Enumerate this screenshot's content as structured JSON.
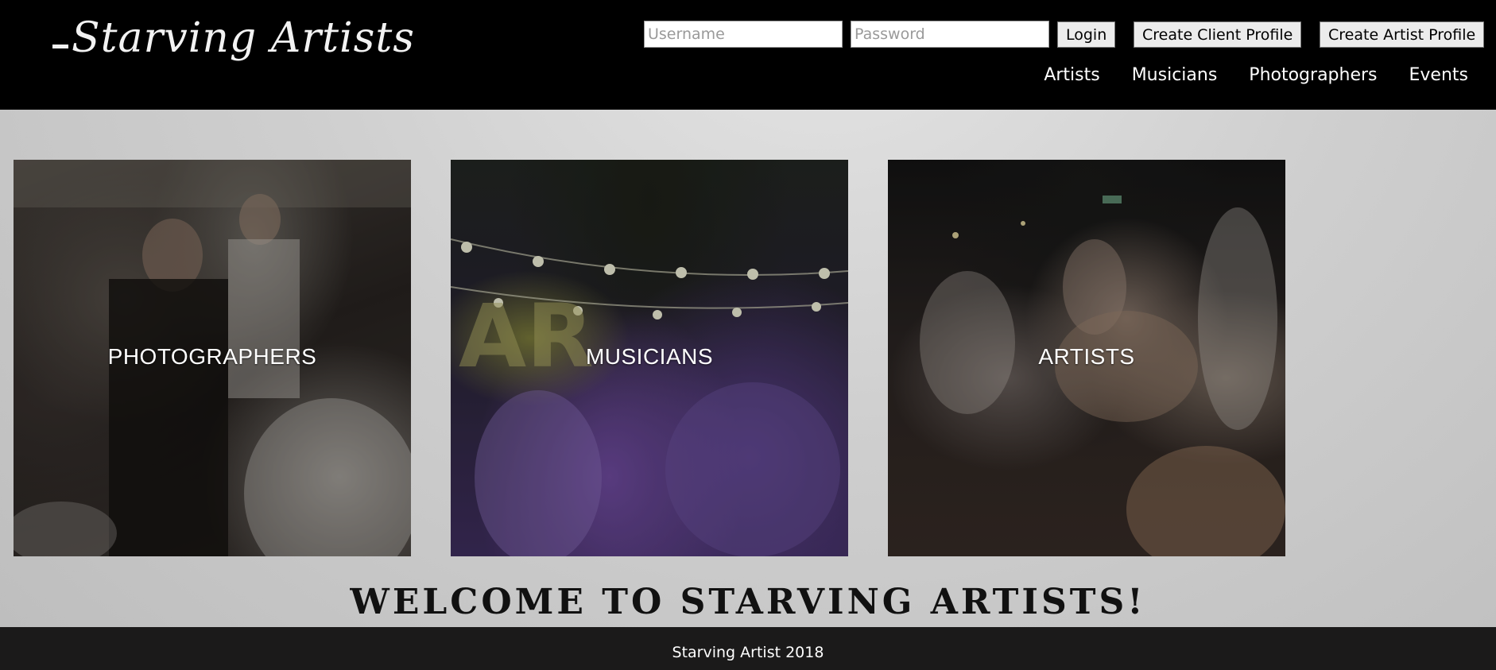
{
  "header": {
    "logo_text": "Starving Artists",
    "login": {
      "username_placeholder": "Username",
      "password_placeholder": "Password",
      "login_label": "Login",
      "create_client_label": "Create Client Profile",
      "create_artist_label": "Create Artist Profile"
    },
    "nav": [
      {
        "label": "Artists"
      },
      {
        "label": "Musicians"
      },
      {
        "label": "Photographers"
      },
      {
        "label": "Events"
      }
    ]
  },
  "tiles": [
    {
      "label": "PHOTOGRAPHERS"
    },
    {
      "label": "MUSICIANS"
    },
    {
      "label": "ARTISTS"
    }
  ],
  "welcome": "WELCOME TO STARVING ARTISTS!",
  "footer": "Starving Artist 2018",
  "colors": {
    "header_bg": "#000000",
    "footer_bg": "#1b1a1a",
    "page_bg": "#cfcfcf"
  }
}
